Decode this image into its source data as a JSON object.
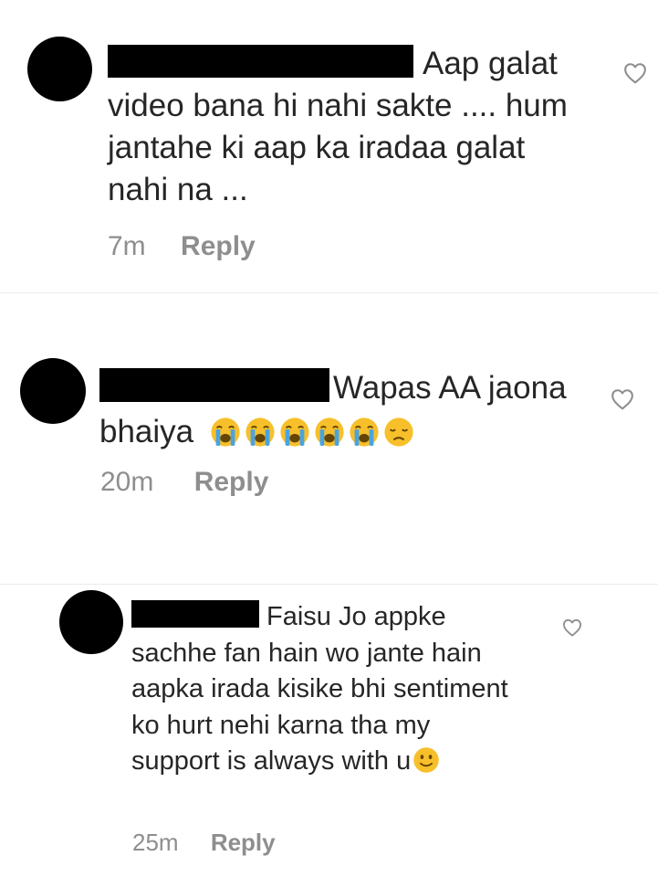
{
  "comments": [
    {
      "username_redacted": true,
      "text": "Aap galat video bana hi nahi sakte .... hum jantahe ki aap ka iradaa galat nahi na ...",
      "time": "7m",
      "reply_label": "Reply",
      "like_icon": "heart-outline-icon"
    },
    {
      "username_redacted": true,
      "text": "Wapas AA jaona bhaiya",
      "emojis": [
        "loudly-crying-face-emoji",
        "loudly-crying-face-emoji",
        "loudly-crying-face-emoji",
        "loudly-crying-face-emoji",
        "loudly-crying-face-emoji",
        "disappointed-face-emoji"
      ],
      "time": "20m",
      "reply_label": "Reply",
      "like_icon": "heart-outline-icon"
    },
    {
      "username_redacted": true,
      "text": "Faisu Jo appke sachhe fan hain wo jante hain aapka irada kisike bhi sentiment ko hurt nehi karna tha my support is always with u",
      "emojis": [
        "slightly-smiling-face-emoji"
      ],
      "time": "25m",
      "reply_label": "Reply",
      "like_icon": "heart-outline-icon"
    }
  ],
  "colors": {
    "text": "#262626",
    "meta": "#8e8e8e",
    "divider": "#ebebeb",
    "emoji_yellow": "#f7c02b",
    "tear_blue": "#4aa3df"
  }
}
